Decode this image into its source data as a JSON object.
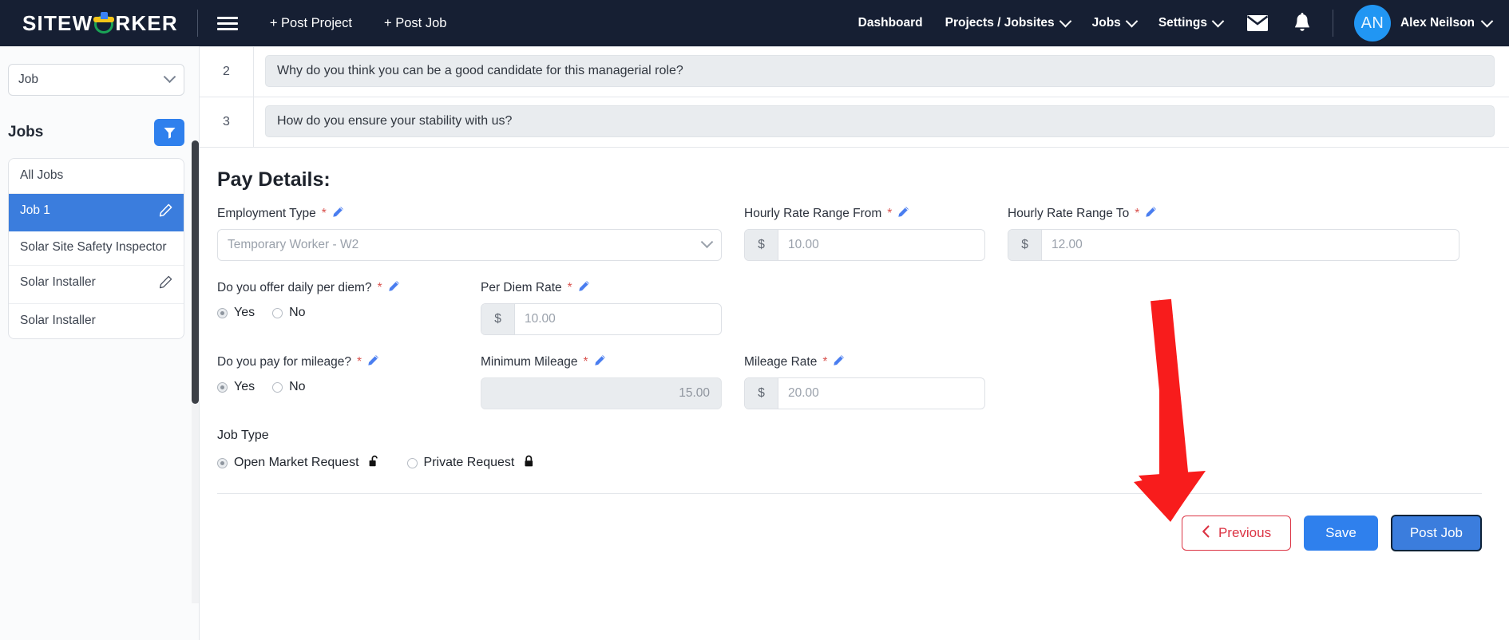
{
  "topnav": {
    "logo_text_left": "SITEW",
    "logo_text_right": "RKER",
    "logo_icon": "hardhat-icon",
    "menu_icon": "hamburger-icon",
    "post_project": "+ Post Project",
    "post_job": "+ Post Job",
    "links": [
      {
        "label": "Dashboard",
        "has_caret": false
      },
      {
        "label": "Projects / Jobsites",
        "has_caret": true
      },
      {
        "label": "Jobs",
        "has_caret": true
      },
      {
        "label": "Settings",
        "has_caret": true
      }
    ],
    "mail_icon": "mail-icon",
    "bell_icon": "bell-icon",
    "avatar_initials": "AN",
    "username": "Alex Neilson",
    "avatar_color": "#2196f3"
  },
  "sidebar": {
    "job_select_value": "Job",
    "jobs_heading": "Jobs",
    "filter_icon": "filter-icon",
    "filter_color": "#2f80ed",
    "items": [
      {
        "label": "All Jobs",
        "active": false,
        "editable": false
      },
      {
        "label": "Job 1",
        "active": true,
        "editable": true
      },
      {
        "label": "Solar Site Safety Inspector",
        "active": false,
        "editable": false
      },
      {
        "label": "Solar Installer",
        "active": false,
        "editable": true
      },
      {
        "label": "Solar Installer",
        "active": false,
        "editable": false
      }
    ]
  },
  "questions": {
    "rows": [
      {
        "num": "2",
        "text": "Why do you think you can be a good candidate for this managerial role?"
      },
      {
        "num": "3",
        "text": "How do you ensure your stability with us?"
      }
    ]
  },
  "pay_details": {
    "title": "Pay Details:",
    "employment_type": {
      "label": "Employment Type",
      "required": "*",
      "value": "Temporary Worker - W2"
    },
    "hourly_from": {
      "label": "Hourly Rate Range From",
      "required": "*",
      "prefix": "$",
      "value": "10.00"
    },
    "hourly_to": {
      "label": "Hourly Rate Range To",
      "required": "*",
      "prefix": "$",
      "value": "12.00"
    },
    "per_diem_question": {
      "label": "Do you offer daily per diem?",
      "required": "*",
      "yes": "Yes",
      "no": "No",
      "selected": "Yes"
    },
    "per_diem_rate": {
      "label": "Per Diem Rate",
      "required": "*",
      "prefix": "$",
      "value": "10.00"
    },
    "mileage_question": {
      "label": "Do you pay for mileage?",
      "required": "*",
      "yes": "Yes",
      "no": "No",
      "selected": "Yes"
    },
    "minimum_mileage": {
      "label": "Minimum Mileage",
      "required": "*",
      "value": "15.00"
    },
    "mileage_rate": {
      "label": "Mileage Rate",
      "required": "*",
      "prefix": "$",
      "value": "20.00"
    },
    "job_type": {
      "title": "Job Type",
      "open_label": "Open Market Request",
      "open_icon": "unlock-icon",
      "private_label": "Private Request",
      "private_icon": "lock-icon",
      "selected": "Open Market Request"
    },
    "edit_icon": "pencil-icon"
  },
  "footer": {
    "previous": "Previous",
    "previous_icon": "chevron-left-icon",
    "save": "Save",
    "post_job": "Post Job"
  },
  "annotation": {
    "arrow_icon": "red-arrow-icon",
    "arrow_color": "#f81c1c"
  }
}
